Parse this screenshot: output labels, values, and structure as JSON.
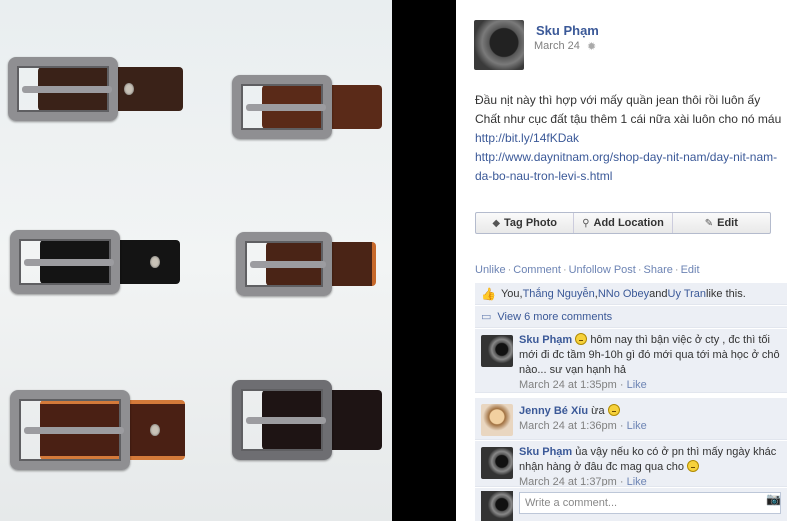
{
  "photo": {
    "alt": ""
  },
  "post": {
    "author": "Sku Phạm",
    "date": "March 24",
    "text_line1": "Đầu nịt này thì hợp với mấy quần jean thôi rồi luôn ấy",
    "text_line2": "Chất như cục đất tậu thêm 1 cái nữa xài luôn cho nó máu",
    "link1": "http://bit.ly/14fKDak",
    "link2": "http://www.daynitnam.org/shop-day-nit-nam/day-nit-nam-da-bo-nau-tron-levi-s.html"
  },
  "buttons": {
    "tag_photo": "Tag Photo",
    "add_location": "Add Location",
    "edit": "Edit"
  },
  "actions": {
    "unlike": "Unlike",
    "comment": "Comment",
    "unfollow": "Unfollow Post",
    "share": "Share",
    "edit": "Edit"
  },
  "likes": {
    "you": "You, ",
    "user1": "Thắng Nguyễn",
    "comma": ", ",
    "user2": "NNo Obey",
    "and": " and ",
    "user3": "Uy Tran",
    "tail": " like this."
  },
  "more_comments": "View 6 more comments",
  "comments": [
    {
      "name": "Sku Phạm",
      "text": "hôm nay thì bận việc ở cty , đc thì tối mới đi đc tầm 9h-10h gì đó mới qua tới mà học ở chô nào... sư vạn hạnh hả",
      "time": "March 24 at 1:35pm",
      "like": "Like"
    },
    {
      "name": "Jenny Bé Xíu",
      "text": "ừa",
      "time": "March 24 at 1:36pm",
      "like": "Like"
    },
    {
      "name": "Sku Phạm",
      "text": "ủa vậy nếu ko có ở pn thì mấy ngày khác nhận hàng ở đâu đc mag qua cho",
      "time": "March 24 at 1:37pm",
      "like": "Like"
    }
  ],
  "write_comment": {
    "placeholder": "Write a comment..."
  },
  "colors": {
    "link": "#3b5998",
    "ufi_bg": "#eceff5",
    "meta": "#808080"
  }
}
